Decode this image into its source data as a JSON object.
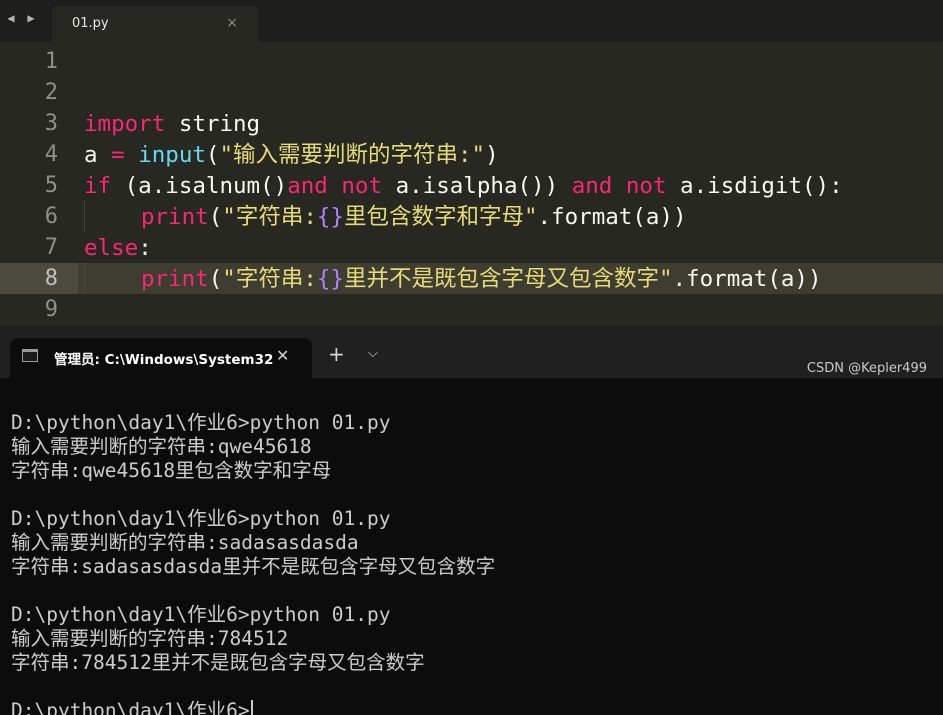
{
  "editor": {
    "tab_label": "01.py",
    "tab_close": "×",
    "nav_back": "◀",
    "nav_forward": "▶",
    "line_numbers": [
      "1",
      "2",
      "3",
      "4",
      "5",
      "6",
      "7",
      "8",
      "9"
    ],
    "code": {
      "l3_kw": "import",
      "l3_rest": " string",
      "l4_a": "a ",
      "l4_eq": "=",
      "l4_sp": " ",
      "l4_fn": "input",
      "l4_p1": "(",
      "l4_str": "\"输入需要判断的字符串:\"",
      "l4_p2": ")",
      "l5_kw1": "if",
      "l5_t1": " (a.isalnum()",
      "l5_kw2": "and",
      "l5_sp": " ",
      "l5_kw3": "not",
      "l5_t2": " a.isalpha()) ",
      "l5_kw4": "and",
      "l5_sp2": " ",
      "l5_kw5": "not",
      "l5_t3": " a.isdigit():",
      "l6_fn": "print",
      "l6_p1": "(",
      "l6_s1": "\"字符串:",
      "l6_br": "{}",
      "l6_s2": "里包含数字和字母\"",
      "l6_rest": ".format(a))",
      "l7_kw": "else",
      "l7_rest": ":",
      "l8_fn": "print",
      "l8_p1": "(",
      "l8_s1": "\"字符串:",
      "l8_br": "{}",
      "l8_s2": "里并不是既包含字母又包含数字\"",
      "l8_rest": ".format(a))"
    }
  },
  "terminal": {
    "tab_title": "管理员: C:\\Windows\\System32",
    "close": "✕",
    "add": "+",
    "dropdown": "⌵",
    "lines": [
      "D:\\python\\day1\\作业6>python 01.py",
      "输入需要判断的字符串:qwe45618",
      "字符串:qwe45618里包含数字和字母",
      "",
      "D:\\python\\day1\\作业6>python 01.py",
      "输入需要判断的字符串:sadasasdasda",
      "字符串:sadasasdasda里并不是既包含字母又包含数字",
      "",
      "D:\\python\\day1\\作业6>python 01.py",
      "输入需要判断的字符串:784512",
      "字符串:784512里并不是既包含字母又包含数字",
      "",
      "D:\\python\\day1\\作业6>"
    ]
  },
  "watermark": "CSDN @Kepler499",
  "colors": {
    "editor_bg": "#272822",
    "keyword": "#f92672",
    "function": "#66d9ef",
    "string": "#e6db74",
    "placeholder": "#ae81ff",
    "terminal_bg": "#0c0c0c"
  }
}
